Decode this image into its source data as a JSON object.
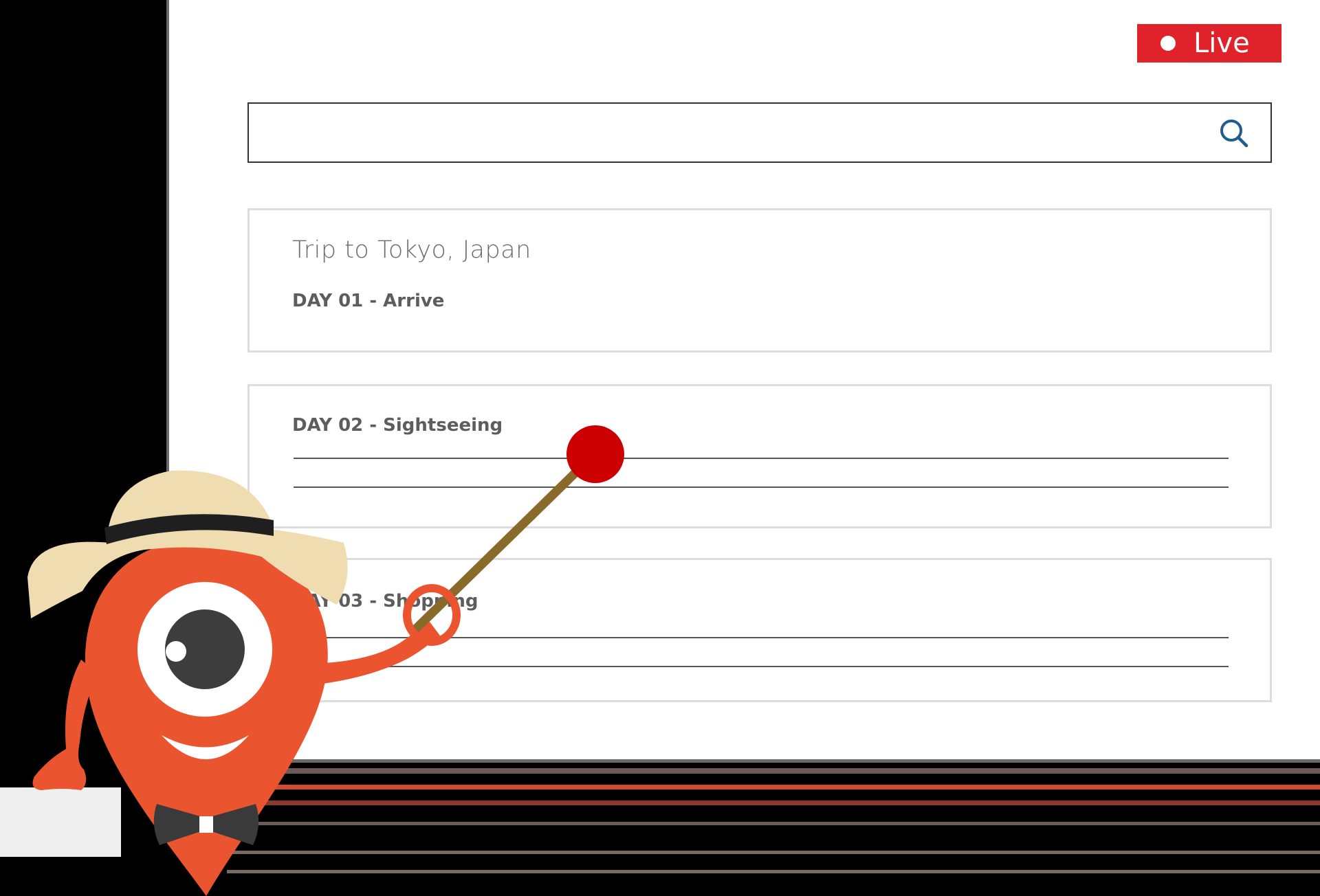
{
  "live_badge": {
    "label": "Live"
  },
  "search": {
    "value": "",
    "placeholder": ""
  },
  "itinerary": {
    "title": "Trip to Tokyo, Japan",
    "days": [
      {
        "label": "DAY 01 - Arrive"
      },
      {
        "label": "DAY 02 - Sightseeing"
      },
      {
        "label": "DAY 03 - Shopping"
      }
    ]
  },
  "icons": {
    "search": "search-icon",
    "live_dot": "record-dot-icon",
    "mascot": "map-pin-mascot-illustration"
  },
  "colors": {
    "live_red": "#e0232a",
    "search_icon": "#1f5d8c",
    "mascot_orange": "#ea5530",
    "pointer_tip": "#cc0000",
    "hat": "#efdcb0"
  }
}
